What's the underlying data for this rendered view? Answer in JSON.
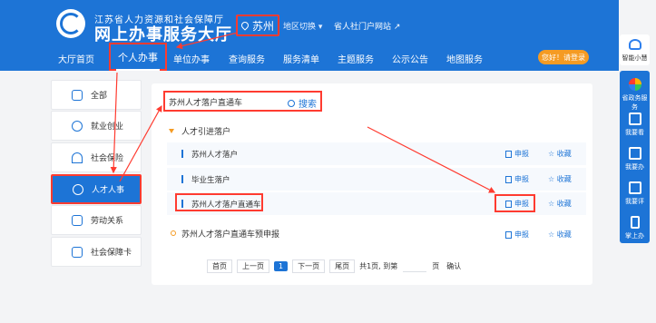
{
  "header": {
    "org_name": "江苏省人力资源和社会保障厅",
    "site_title": "网上办事服务大厅",
    "city": "苏州",
    "region_switch": "地区切换 ▾",
    "portal_link": "省人社门户网站 ↗",
    "login_label": "您好！请登录"
  },
  "nav": {
    "items": [
      "大厅首页",
      "个人办事",
      "单位办事",
      "查询服务",
      "服务清单",
      "主题服务",
      "公示公告",
      "地图服务"
    ],
    "active": "个人办事"
  },
  "rail": {
    "top_label": "智能小慧",
    "items": [
      "省政务服务",
      "我要看",
      "我要办",
      "我要评",
      "掌上办"
    ]
  },
  "sidebar": {
    "items": [
      "全部",
      "就业创业",
      "社会保险",
      "人才人事",
      "劳动关系",
      "社会保障卡"
    ],
    "active": "人才人事"
  },
  "search": {
    "value": "苏州人才落户直通车",
    "button": "搜索"
  },
  "category": {
    "title": "人才引进落户"
  },
  "services": [
    {
      "name": "苏州人才落户",
      "declare": "申报",
      "favorite": "☆ 收藏"
    },
    {
      "name": "毕业生落户",
      "declare": "申报",
      "favorite": "☆ 收藏"
    },
    {
      "name": "苏州人才落户直通车",
      "declare": "申报",
      "favorite": "☆ 收藏"
    }
  ],
  "pre_declare": {
    "name": "苏州人才落户直通车预申报",
    "declare": "申报",
    "favorite": "☆ 收藏"
  },
  "pager": {
    "first": "首页",
    "prev": "上一页",
    "current": "1",
    "next": "下一页",
    "last": "尾页",
    "total": "共1页, 到第",
    "page_suffix": "页",
    "confirm": "确认"
  },
  "colors": {
    "brand": "#1d74d6",
    "highlight": "#ff3b30",
    "accent": "#f59b23"
  }
}
